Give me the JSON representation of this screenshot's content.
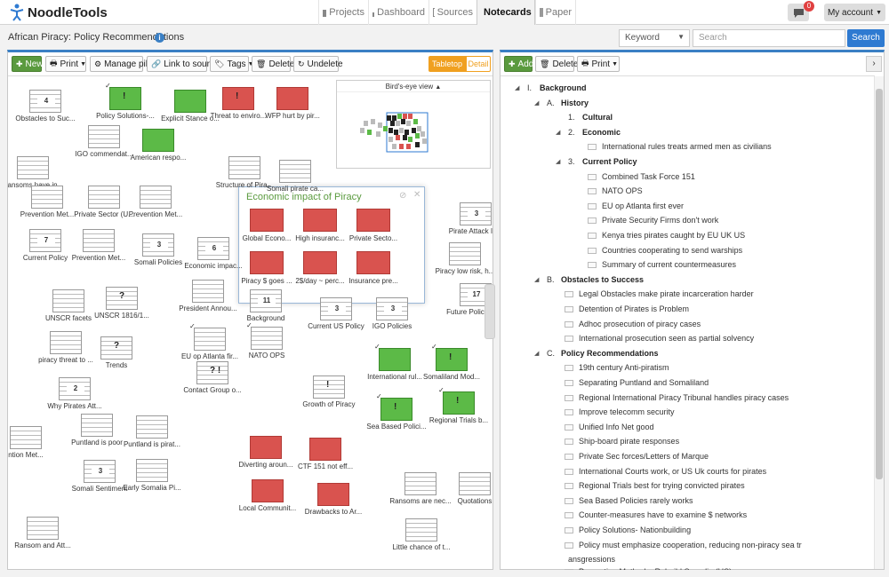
{
  "app": {
    "name": "NoodleTools"
  },
  "nav": [
    {
      "label": "Projects",
      "icon": "folder-icon"
    },
    {
      "label": "Dashboard",
      "icon": "bar-chart-icon"
    },
    {
      "label": "Sources",
      "icon": "list-icon"
    },
    {
      "label": "Notecards",
      "icon": "grid-icon"
    },
    {
      "label": "Paper",
      "icon": "document-icon"
    }
  ],
  "messages": {
    "count": "0"
  },
  "account": {
    "label": "My account"
  },
  "project": {
    "title": "African Piracy: Policy Recommendations"
  },
  "search": {
    "scope": "Keyword",
    "placeholder": "Search",
    "button": "Search"
  },
  "left_toolbar": {
    "new": "New",
    "print": "Print",
    "manage_pile": "Manage pile",
    "link_to_source": "Link to source",
    "tags": "Tags",
    "delete": "Delete",
    "undelete": "Undelete",
    "tabletop": "Tabletop",
    "detail": "Detail"
  },
  "birds_eye": {
    "title": "Bird's-eye view"
  },
  "cards": [
    {
      "label": "Obstacles to Suc...",
      "num": "4",
      "color": "w",
      "stack": true
    },
    {
      "label": "Policy Solutions-...",
      "color": "g",
      "mark": "!",
      "check": true
    },
    {
      "label": "Explicit Stance o...",
      "color": "g"
    },
    {
      "label": "Threat to enviro...",
      "color": "r",
      "mark": "!"
    },
    {
      "label": "WFP hurt by pir...",
      "color": "r"
    },
    {
      "label": "IGO commendat...",
      "color": "w"
    },
    {
      "label": "American respo...",
      "color": "g"
    },
    {
      "label": "Ransoms have in...",
      "color": "w"
    },
    {
      "label": "Structure of Pira...",
      "color": "w"
    },
    {
      "label": "Somali pirate ca...",
      "color": "w"
    },
    {
      "label": "Prevention Met...",
      "color": "w"
    },
    {
      "label": "Private Sector (U...",
      "color": "w"
    },
    {
      "label": "Prevention Met...",
      "color": "w"
    },
    {
      "label": "Current Policy",
      "num": "7",
      "color": "w",
      "stack": true
    },
    {
      "label": "Prevention Met...",
      "color": "w"
    },
    {
      "label": "Somali Policies",
      "num": "3",
      "color": "w",
      "stack": true
    },
    {
      "label": "Economic impac...",
      "num": "6",
      "color": "w",
      "stack": true
    },
    {
      "label": "Pirate Attack Info",
      "num": "3",
      "color": "w",
      "stack": true
    },
    {
      "label": "Piracy low risk, h...",
      "color": "w"
    },
    {
      "label": "UNSCR facets",
      "color": "w"
    },
    {
      "label": "UNSCR 1816/1...",
      "mark": "?",
      "color": "w"
    },
    {
      "label": "President Annou...",
      "color": "w"
    },
    {
      "label": "Background",
      "num": "11",
      "color": "w"
    },
    {
      "label": "Current US Policy",
      "num": "3",
      "color": "w",
      "stack": true
    },
    {
      "label": "IGO Policies",
      "num": "3",
      "color": "w",
      "stack": true
    },
    {
      "label": "Future Policy Re...",
      "num": "17",
      "color": "w",
      "stack": true
    },
    {
      "label": "piracy threat to ...",
      "color": "w"
    },
    {
      "label": "Trends",
      "mark": "?",
      "color": "w"
    },
    {
      "label": "EU op Atlanta fir...",
      "color": "w",
      "check": true
    },
    {
      "label": "NATO OPS",
      "color": "w",
      "check": true
    },
    {
      "label": "International rul...",
      "color": "g",
      "check": true
    },
    {
      "label": "Somaliland Mod...",
      "color": "g",
      "mark": "!",
      "check": true
    },
    {
      "label": "Why Pirates Att...",
      "num": "2",
      "color": "w",
      "stack": true
    },
    {
      "label": "Contact Group o...",
      "mark": "? !",
      "color": "w"
    },
    {
      "label": "Growth of Piracy",
      "mark": "!",
      "color": "w"
    },
    {
      "label": "Sea Based Polici...",
      "color": "g",
      "mark": "!",
      "check": true
    },
    {
      "label": "Regional Trials b...",
      "color": "g",
      "mark": "!",
      "check": true
    },
    {
      "label": "ntion Met...",
      "color": "w"
    },
    {
      "label": "Puntland is poor",
      "color": "w"
    },
    {
      "label": "Puntland is pirat...",
      "color": "w"
    },
    {
      "label": "Diverting aroun...",
      "color": "r"
    },
    {
      "label": "CTF 151 not eff...",
      "color": "r"
    },
    {
      "label": "Somali Sentiment",
      "num": "3",
      "color": "w",
      "stack": true
    },
    {
      "label": "Early Somalia Pi...",
      "color": "w"
    },
    {
      "label": "Local Communit...",
      "color": "r"
    },
    {
      "label": "Drawbacks to Ar...",
      "color": "r"
    },
    {
      "label": "Ransoms are nec...",
      "color": "w"
    },
    {
      "label": "Quotations",
      "color": "w"
    },
    {
      "label": "Ransom and Att...",
      "color": "w"
    },
    {
      "label": "Little chance of t...",
      "color": "w"
    }
  ],
  "popup": {
    "title": "Economic impact of Piracy",
    "cards": [
      "Global Econo...",
      "High insuranc...",
      "Private Secto...",
      "Piracy $ goes ...",
      "2$/day ~ perc...",
      "Insurance pre..."
    ],
    "partial_label": "ay pira wa..."
  },
  "right_toolbar": {
    "add": "Add",
    "delete": "Delete",
    "print": "Print",
    "expand": "›"
  },
  "outline": [
    {
      "marker": "I.",
      "text": "Background",
      "level": 0,
      "bold": true,
      "tri": true
    },
    {
      "marker": "A.",
      "text": "History",
      "level": 1,
      "bold": true,
      "tri": true
    },
    {
      "marker": "1.",
      "text": "Cultural",
      "level": 2,
      "bold": true
    },
    {
      "marker": "2.",
      "text": "Economic",
      "level": 2,
      "bold": true,
      "tri": true
    },
    {
      "text": "International rules treats armed men as civilians",
      "level": 3
    },
    {
      "marker": "3.",
      "text": "Current Policy",
      "level": 2,
      "bold": true,
      "tri": true
    },
    {
      "text": "Combined Task Force 151",
      "level": 3
    },
    {
      "text": "NATO OPS",
      "level": 3
    },
    {
      "text": "EU op Atlanta first ever",
      "level": 3
    },
    {
      "text": "Private Security Firms don't work",
      "level": 3
    },
    {
      "text": "Kenya tries pirates caught by EU UK US",
      "level": 3
    },
    {
      "text": "Countries cooperating to send warships",
      "level": 3
    },
    {
      "text": "Summary of current countermeasures",
      "level": 3
    },
    {
      "marker": "B.",
      "text": "Obstacles to Success",
      "level": 1,
      "bold": true,
      "tri": true
    },
    {
      "text": "Legal Obstacles make pirate incarceration harder",
      "level": 2
    },
    {
      "text": "Detention of Pirates is Problem",
      "level": 2
    },
    {
      "text": "Adhoc prosecution of piracy cases",
      "level": 2
    },
    {
      "text": "International prosecution seen as partial solvency",
      "level": 2
    },
    {
      "marker": "C.",
      "text": "Policy Recommendations",
      "level": 1,
      "bold": true,
      "tri": true
    },
    {
      "text": "19th century Anti-piratism",
      "level": 2
    },
    {
      "text": "Separating Puntland and Somaliland",
      "level": 2
    },
    {
      "text": "Regional International Piracy Tribunal handles piracy cases",
      "level": 2
    },
    {
      "text": "Improve telecomm security",
      "level": 2
    },
    {
      "text": "Unified Info Net good",
      "level": 2
    },
    {
      "text": "Ship-board pirate responses",
      "level": 2
    },
    {
      "text": "Private Sec forces/Letters of Marque",
      "level": 2
    },
    {
      "text": "International Courts work, or US Uk courts for pirates",
      "level": 2
    },
    {
      "text": "Regional Trials best for trying convicted pirates",
      "level": 2
    },
    {
      "text": "Sea Based Policies rarely works",
      "level": 2
    },
    {
      "text": "Counter-measures have to examine $ networks",
      "level": 2
    },
    {
      "text": "Policy Solutions- Nationbuilding",
      "level": 2
    },
    {
      "text": "Policy must emphasize cooperation, reducing non-piracy sea tr",
      "level": 2
    },
    {
      "text": "ansgressions",
      "level": 2,
      "cont": true
    },
    {
      "text": "Prevention Methods- Rebuild Somalia (US)",
      "level": 2
    }
  ],
  "colors": {
    "accent": "#3a7fc4",
    "green_card": "#5cba47",
    "red_card": "#d9534f",
    "tabletop": "#f0a020"
  }
}
